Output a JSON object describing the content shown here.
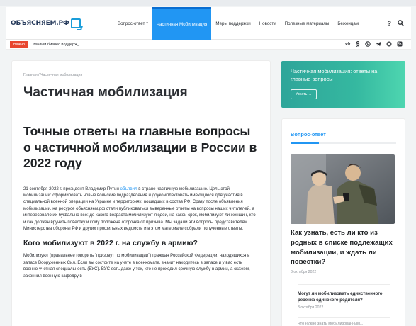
{
  "site": {
    "logo_text": "ОБЪЯСНЯЕМ.РФ"
  },
  "nav": {
    "items": [
      {
        "label": "Вопрос-ответ",
        "has_caret": true
      },
      {
        "label": "Частичная Мобилизация",
        "active": true
      },
      {
        "label": "Меры поддержки"
      },
      {
        "label": "Новости"
      },
      {
        "label": "Полезные материалы"
      },
      {
        "label": "Беженцам"
      }
    ],
    "caret": "▾",
    "help_icon": "?",
    "search_icon": "search-icon",
    "accent": "#2196f3"
  },
  "ticker": {
    "badge": "Важно",
    "text": "Малый бизнес поддерж_",
    "badge_color": "#e8462f"
  },
  "social": [
    "vk-icon",
    "ok-icon",
    "viber-icon",
    "telegram-icon",
    "dzen-icon",
    "rss-icon"
  ],
  "article": {
    "breadcrumb": "Главная / Частичная мобилизация",
    "page_title": "Частичная мобилизация",
    "title": "Точные ответы на главные вопросы о частичной мобилизации в России в 2022 году",
    "intro_before_link": "21 сентября 2022 г. президент Владимир Путин ",
    "intro_link": "объявил",
    "intro_after_link": " в стране частичную мобилизацию. Цель этой мобилизации: сформировать новые воинские подразделения и доукомплектовать имеющиеся для участия в специальной военной операции на Украине и территориях, вошедших в состав РФ. Сразу после объявления мобилизации, на ресурсе объясняем.рф стали публиковаться выверенные ответы на вопросы наших читателей, а интересовало их буквально все: до какого возраста мобилизуют людей, на какой срок, мобилизуют ли женщин, кто и как должен вручить повестку и кому положена отсрочка от призыва. Мы задали эти вопросы представителям Министерства обороны РФ и других профильных ведомств и в этом материале  собрали полученные ответы.",
    "h2": "Кого мобилизуют в 2022 г. на службу в армию?",
    "p2": "Мобилизуют (правильнее говорить \"призовут по мобилизации\") граждан Российской Федерации, находящихся в запасе Вооруженных Сил. Если вы состоите на учете в военкомате, значит находитесь в запасе и у вас есть военно-учетная специальность (ВУС). ВУС есть даже у тех, кто не проходил срочную службу в армии, а скажем, закончил военную кафедру в"
  },
  "sidebar": {
    "banner": {
      "title": "Частичная мобилизация: ответы на главные вопросы",
      "button": "Узнать →"
    },
    "widget": {
      "title": "Вопрос-ответ",
      "card_title": "Как узнать, есть ли кто из родных в списке подлежащих мобилизации, и ждать ли повестки?",
      "card_date": "3 октября 2022",
      "related_title": "Могут ли мобилизовать единственного ребенка одинокого родителя?",
      "related_date": "3 октября 2022",
      "more_text": "Что нужно знать мобилизованным..."
    }
  }
}
